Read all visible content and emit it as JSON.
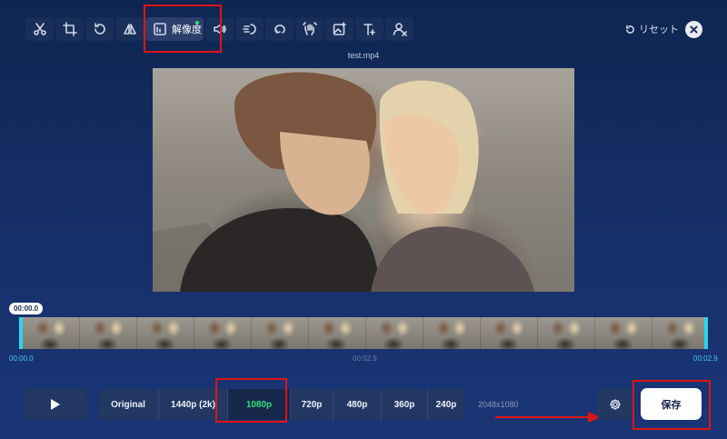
{
  "toolbar": {
    "tools": [
      "scissors-icon",
      "crop-icon",
      "rotate-icon",
      "flip-icon",
      "resolution-icon",
      "volume-icon",
      "speed-icon",
      "loop-icon",
      "stabilize-icon",
      "image-icon",
      "text-icon",
      "remove-person-icon"
    ],
    "active_label": "解像度",
    "reset_label": "リセット"
  },
  "video": {
    "filename": "test.mp4"
  },
  "timeline": {
    "current_time": "00:00.0",
    "start_time": "00:00.0",
    "mid_time": "00:02.9",
    "end_time": "00:02.9"
  },
  "resolutions": {
    "options": [
      "Original",
      "1440p (2k)",
      "1080p",
      "720p",
      "480p",
      "360p",
      "240p"
    ],
    "selected": "1080p",
    "size": "2048x1080"
  },
  "actions": {
    "save_label": "保存"
  },
  "colors": {
    "accent_green": "#2ee07a",
    "highlight_red": "#e01414",
    "timeline_cyan": "#2bd5ee"
  }
}
